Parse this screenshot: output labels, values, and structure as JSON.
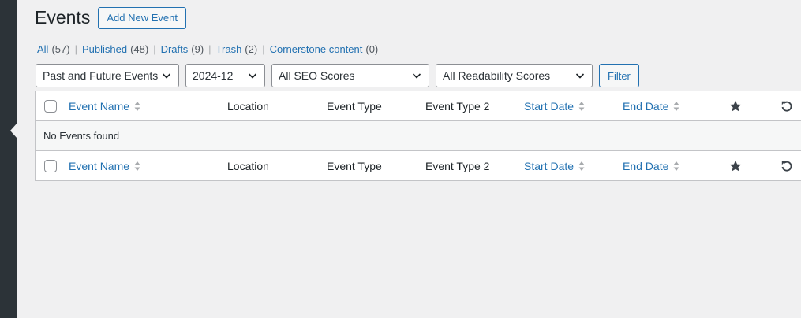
{
  "page": {
    "title": "Events",
    "add_new_label": "Add New Event"
  },
  "views": [
    {
      "label": "All",
      "count": "(57)"
    },
    {
      "label": "Published",
      "count": "(48)"
    },
    {
      "label": "Drafts",
      "count": "(9)"
    },
    {
      "label": "Trash",
      "count": "(2)"
    },
    {
      "label": "Cornerstone content",
      "count": "(0)"
    }
  ],
  "view_separator": "|",
  "filters": {
    "scope": "Past and Future Events",
    "month": "2024-12",
    "seo": "All SEO Scores",
    "readability": "All Readability Scores",
    "button_label": "Filter"
  },
  "table": {
    "columns": {
      "event_name": "Event Name",
      "location": "Location",
      "event_type": "Event Type",
      "event_type_2": "Event Type 2",
      "start_date": "Start Date",
      "end_date": "End Date"
    },
    "empty_message": "No Events found"
  },
  "icons": {
    "featured": "star-icon",
    "refresh": "undo-icon",
    "sort": "sort-arrows-icon",
    "dropdown": "chevron-down-icon"
  },
  "colors": {
    "accent": "#2271b1",
    "sidebar": "#2c3338",
    "background": "#f0f0f1"
  }
}
